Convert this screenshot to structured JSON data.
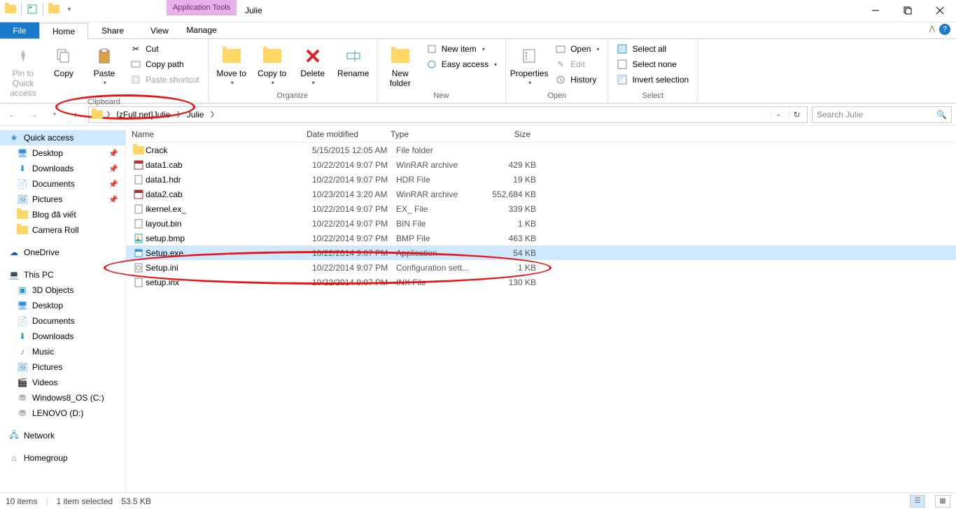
{
  "title": "Julie",
  "context_tab": "Application Tools",
  "tabs": {
    "file": "File",
    "home": "Home",
    "share": "Share",
    "view": "View",
    "manage": "Manage"
  },
  "ribbon": {
    "clipboard": {
      "label": "Clipboard",
      "pin": "Pin to Quick access",
      "copy": "Copy",
      "paste": "Paste",
      "cut": "Cut",
      "copy_path": "Copy path",
      "paste_shortcut": "Paste shortcut"
    },
    "organize": {
      "label": "Organize",
      "move_to": "Move to",
      "copy_to": "Copy to",
      "delete": "Delete",
      "rename": "Rename"
    },
    "new": {
      "label": "New",
      "new_folder": "New folder",
      "new_item": "New item",
      "easy_access": "Easy access"
    },
    "open": {
      "label": "Open",
      "properties": "Properties",
      "open": "Open",
      "edit": "Edit",
      "history": "History"
    },
    "select": {
      "label": "Select",
      "select_all": "Select all",
      "select_none": "Select none",
      "invert": "Invert selection"
    }
  },
  "breadcrumb": {
    "item1": "[zFull.net]Julie",
    "item2": "Julie"
  },
  "search_placeholder": "Search Julie",
  "nav": {
    "quick_access": "Quick access",
    "desktop": "Desktop",
    "downloads": "Downloads",
    "documents": "Documents",
    "pictures": "Pictures",
    "blog": "Blog đã viết",
    "camera": "Camera Roll",
    "onedrive": "OneDrive",
    "thispc": "This PC",
    "objects3d": "3D Objects",
    "desktop2": "Desktop",
    "documents2": "Documents",
    "downloads2": "Downloads",
    "music": "Music",
    "pictures2": "Pictures",
    "videos": "Videos",
    "drive_c": "Windows8_OS (C:)",
    "drive_d": "LENOVO (D:)",
    "network": "Network",
    "homegroup": "Homegroup"
  },
  "columns": {
    "name": "Name",
    "date": "Date modified",
    "type": "Type",
    "size": "Size"
  },
  "files": [
    {
      "name": "Crack",
      "date": "5/15/2015 12:05 AM",
      "type": "File folder",
      "size": "",
      "icon": "folder"
    },
    {
      "name": "data1.cab",
      "date": "10/22/2014 9:07 PM",
      "type": "WinRAR archive",
      "size": "429 KB",
      "icon": "rar"
    },
    {
      "name": "data1.hdr",
      "date": "10/22/2014 9:07 PM",
      "type": "HDR File",
      "size": "19 KB",
      "icon": "file"
    },
    {
      "name": "data2.cab",
      "date": "10/23/2014 3:20 AM",
      "type": "WinRAR archive",
      "size": "552,684 KB",
      "icon": "rar"
    },
    {
      "name": "ikernel.ex_",
      "date": "10/22/2014 9:07 PM",
      "type": "EX_ File",
      "size": "339 KB",
      "icon": "file"
    },
    {
      "name": "layout.bin",
      "date": "10/22/2014 9:07 PM",
      "type": "BIN File",
      "size": "1 KB",
      "icon": "file"
    },
    {
      "name": "setup.bmp",
      "date": "10/22/2014 9:07 PM",
      "type": "BMP File",
      "size": "463 KB",
      "icon": "bmp"
    },
    {
      "name": "Setup.exe",
      "date": "10/22/2014 9:07 PM",
      "type": "Application",
      "size": "54 KB",
      "icon": "exe",
      "selected": true
    },
    {
      "name": "Setup.ini",
      "date": "10/22/2014 9:07 PM",
      "type": "Configuration sett...",
      "size": "1 KB",
      "icon": "ini"
    },
    {
      "name": "setup.inx",
      "date": "10/22/2014 9:07 PM",
      "type": "INX File",
      "size": "130 KB",
      "icon": "file"
    }
  ],
  "status": {
    "count": "10 items",
    "selected": "1 item selected",
    "size": "53.5 KB"
  }
}
